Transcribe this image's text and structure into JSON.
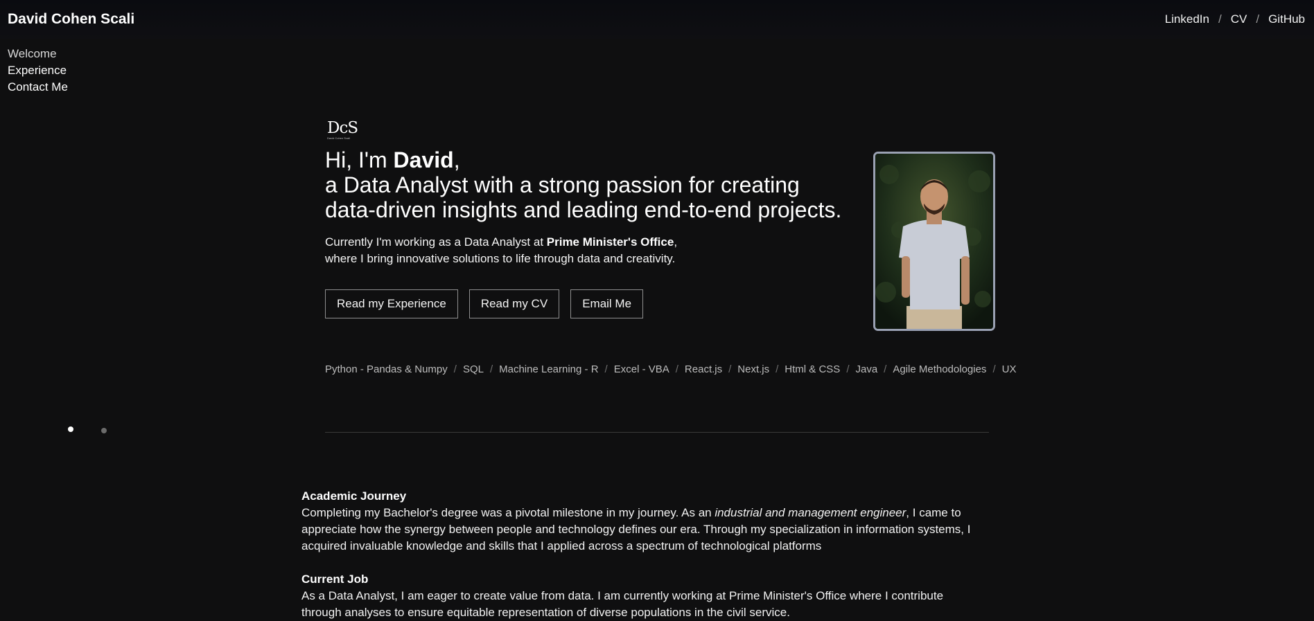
{
  "header": {
    "brand": "David Cohen Scali",
    "links": [
      "LinkedIn",
      "CV",
      "GitHub"
    ],
    "separator": "/"
  },
  "sidenav": {
    "items": [
      "Welcome",
      "Experience",
      "Contact Me"
    ],
    "active_index": 0
  },
  "logo": {
    "mark": "DcS",
    "sub": "David Cohen Scali"
  },
  "hero": {
    "greeting_prefix": "Hi, I'm ",
    "greeting_name": "David",
    "greeting_suffix": ",",
    "lead_line1": "a Data Analyst with a strong passion for creating",
    "lead_line2": "data-driven insights and leading end-to-end projects.",
    "intro_prefix": "Currently I'm working as a Data Analyst at ",
    "intro_org": "Prime Minister's Office",
    "intro_comma": ",",
    "intro_line2": "where I bring innovative solutions to life through data and creativity."
  },
  "buttons": {
    "experience": "Read my Experience",
    "cv": "Read my CV",
    "email": "Email Me"
  },
  "skills": {
    "items": [
      "Python - Pandas & Numpy",
      "SQL",
      "Machine Learning - R",
      "Excel - VBA",
      "React.js",
      "Next.js",
      "Html & CSS",
      "Java",
      "Agile Methodologies",
      "UX"
    ],
    "separator": "/"
  },
  "slider": {
    "count": 2,
    "active": 0
  },
  "sections": {
    "academic_title": "Academic Journey",
    "academic_p1": "Completing my Bachelor's degree was a pivotal milestone in my journey. As an ",
    "academic_em": "industrial and management engineer",
    "academic_p2": ", I came to appreciate how the synergy between people and technology defines our era. Through my specialization in information systems, I acquired invaluable knowledge and skills that I applied across a spectrum of technological platforms",
    "job_title": "Current Job",
    "job_text": "As a Data Analyst, I am eager to create value from data. I am currently working at Prime Minister's Office where I contribute through analyses to ensure equitable representation of diverse populations in the civil service."
  },
  "colors": {
    "background": "#0f0f10",
    "text": "#f2f2f2",
    "muted": "#bdbdbd",
    "photo_border": "#9aa1b3"
  }
}
